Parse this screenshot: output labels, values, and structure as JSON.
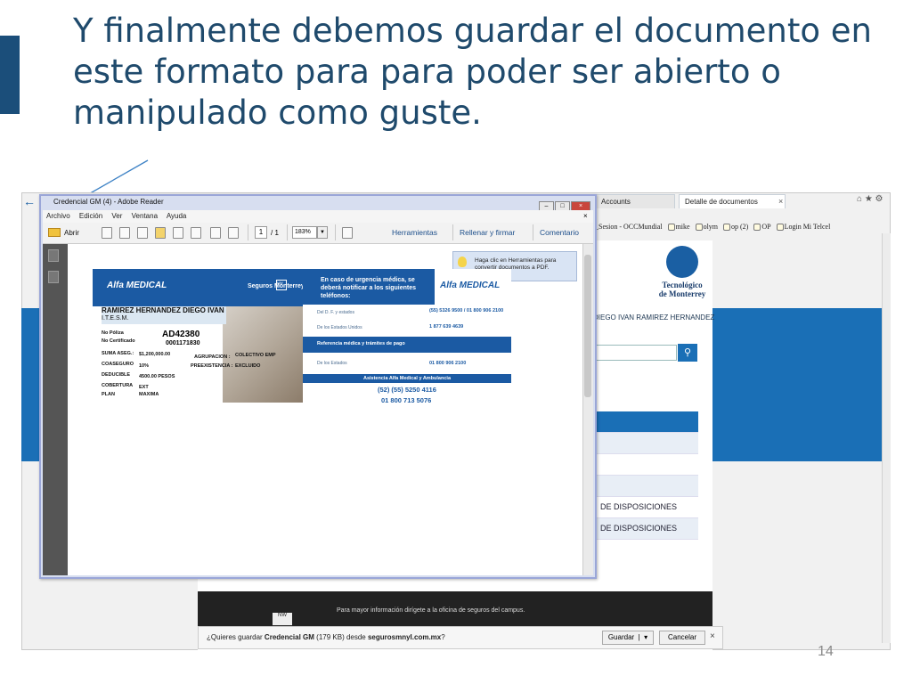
{
  "slide": {
    "title": "Y finalmente debemos guardar el documento en este formato para para poder ser abierto o manipulado como guste.",
    "page_number": "14"
  },
  "browser": {
    "tabs": [
      "Accounts",
      "Detalle de documentos"
    ],
    "tab_close": "×",
    "bookmarks": [
      "_Sesion - OCCMundial",
      "mike",
      "olym",
      "op (2)",
      "OP",
      "Login Mi Telcel"
    ],
    "institution_logo_text": [
      "Tecnológico",
      "de Monterrey"
    ],
    "user_name": "DIEGO IVAN RAMIREZ HERNANDEZ",
    "search_icon": "search-icon",
    "rows": [
      "",
      "",
      "",
      "",
      "DE DISPOSICIONES",
      "DE DISPOSICIONES"
    ],
    "footer_text": "Para mayor información dirígete a la oficina de seguros del campus.",
    "footer_logo": "NW",
    "download_bar": {
      "prefix": "¿Quieres guardar ",
      "file": "Credencial GM",
      "size": " (179 KB) desde ",
      "site": "segurosmnyl.com.mx",
      "suffix": "?",
      "save_label": "Guardar",
      "save_dropdown": "▾",
      "cancel_label": "Cancelar",
      "close": "×"
    }
  },
  "reader": {
    "window_title": "Credencial GM (4) - Adobe Reader",
    "menu": [
      "Archivo",
      "Edición",
      "Ver",
      "Ventana",
      "Ayuda"
    ],
    "menu_close": "×",
    "open_label": "Abrir",
    "page_current": "1",
    "page_total": "/ 1",
    "zoom": "183%",
    "tools_label": "Herramientas",
    "fill_sign_label": "Rellenar y firmar",
    "comment_label": "Comentario",
    "tooltip": "Haga clic en Herramientas para convertir documentos a PDF.",
    "window_buttons": [
      "–",
      "□",
      "×"
    ]
  },
  "card": {
    "brand": "Alfa MEDICAL",
    "insurer": "Seguros Monterrey",
    "insurer_logo": "NW",
    "holder": "RAMIREZ HERNANDEZ DIEGO IVAN",
    "org": "I.T.E.S.M.",
    "poliza_label": "No Póliza",
    "poliza_value": "AD42380",
    "cert_label": "No Certificado",
    "cert_value": "0001171830",
    "suma_label": "SUMA ASEG.:",
    "suma_value": "$1,200,000.00",
    "coaseguro_label": "COASEGURO",
    "coaseguro_value": "10%",
    "deducible_label": "DEDUCIBLE",
    "deducible_value": "4500.00 PESOS",
    "cobertura_label": "COBERTURA",
    "cobertura_value": "EXT",
    "plan_label": "PLAN",
    "plan_value": "MAXIMA",
    "agrupacion_label": "AGRUPACION :",
    "agrupacion_value": "COLECTIVO EMP",
    "preexistencia_label": "PREEXISTENCIA :",
    "preexistencia_value": "EXCLUIDO",
    "urgency_text": "En caso de urgencia médica, se deberá notificar a los siguientes teléfonos:",
    "df_label": "Del D. F. y estados",
    "df_value": "(55) 5326 9500 / 01 800 906 2100",
    "us_label": "De los Estados Unidos",
    "us_value": "1 877 639 4639",
    "ref_bar": "Referencia médica y trámites de pago",
    "estados_label": "De los Estados",
    "estados_value": "01 800 906 2100",
    "asis_bar": "Asistencia Alfa Medical y Ambulancia",
    "asis_phone1": "(52) (55) 5250 4116",
    "asis_phone2": "01 800 713 5076"
  }
}
